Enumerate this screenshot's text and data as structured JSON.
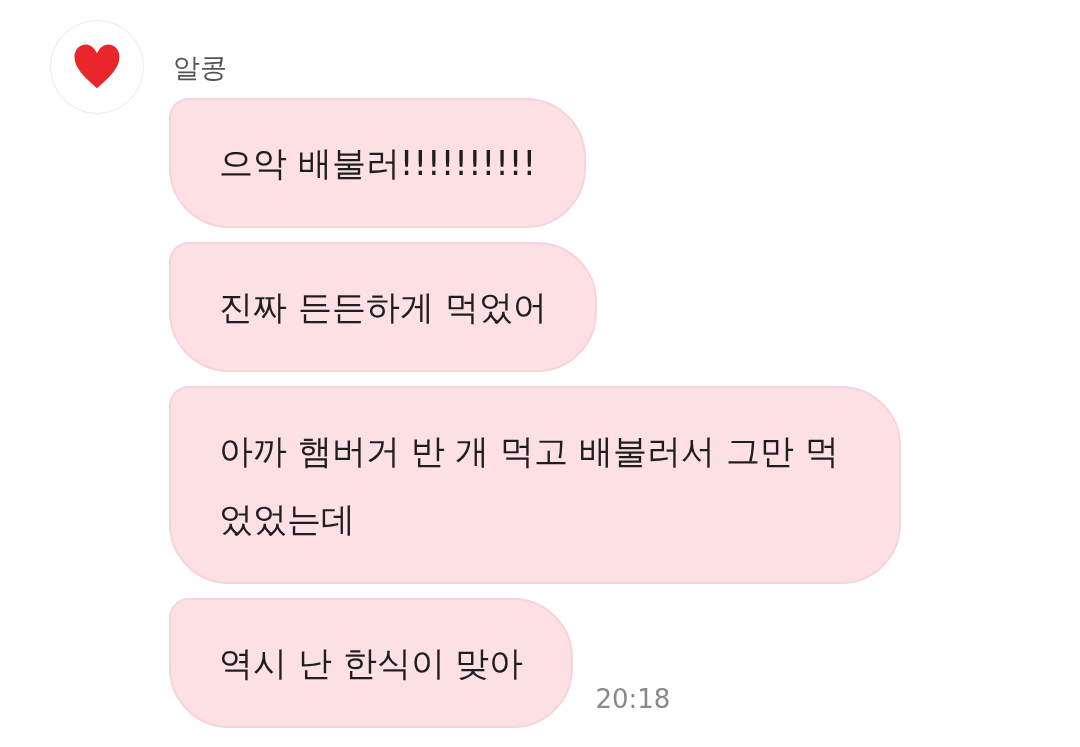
{
  "sender": {
    "name": "알콩"
  },
  "messages": [
    {
      "text": "으악 배불러!!!!!!!!!!"
    },
    {
      "text": "진짜 든든하게 먹었어"
    },
    {
      "text": "아까 햄버거 반 개 먹고 배불러서 그만 먹었었는데"
    },
    {
      "text": "역시 난 한식이 맞아",
      "time": "20:18"
    }
  ]
}
